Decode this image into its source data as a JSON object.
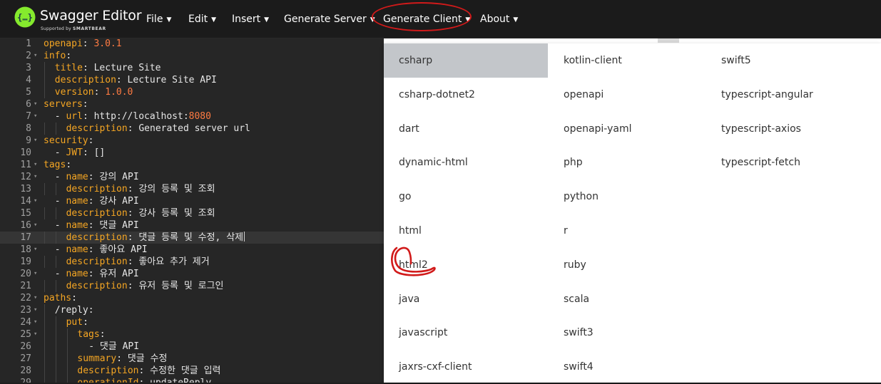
{
  "app": {
    "title": "Swagger Editor",
    "supported_by": "Supported by",
    "supported_by_brand": "SMARTBEAR",
    "brand_color": "#85ea2d"
  },
  "menu": [
    {
      "label": "File"
    },
    {
      "label": "Edit"
    },
    {
      "label": "Insert"
    },
    {
      "label": "Generate Server"
    },
    {
      "label": "Generate Client"
    },
    {
      "label": "About"
    }
  ],
  "annotation_color": "#d11a1a",
  "editor": {
    "active_line": 17,
    "lines": [
      {
        "num": "1",
        "indent": 0,
        "key": "openapi",
        "value": "3.0.1",
        "value_type": "number"
      },
      {
        "num": "2",
        "indent": 0,
        "key": "info",
        "value": "",
        "value_type": "str",
        "fold": true
      },
      {
        "num": "3",
        "indent": 1,
        "key": "title",
        "value": "Lecture Site",
        "value_type": "str"
      },
      {
        "num": "4",
        "indent": 1,
        "key": "description",
        "value": "Lecture Site API",
        "value_type": "str"
      },
      {
        "num": "5",
        "indent": 1,
        "key": "version",
        "value": "1.0.0",
        "value_type": "number"
      },
      {
        "num": "6",
        "indent": 0,
        "key": "servers",
        "value": "",
        "value_type": "str",
        "fold": true
      },
      {
        "num": "7",
        "indent": 1,
        "dash": true,
        "key": "url",
        "value": "http://localhost:",
        "value_type": "str",
        "value_suffix": "8080",
        "fold": true
      },
      {
        "num": "8",
        "indent": 2,
        "key": "description",
        "value": "Generated server url",
        "value_type": "str"
      },
      {
        "num": "9",
        "indent": 0,
        "key": "security",
        "value": "",
        "value_type": "str",
        "fold": true
      },
      {
        "num": "10",
        "indent": 1,
        "dash": true,
        "key": "JWT",
        "value": "[]",
        "value_type": "str"
      },
      {
        "num": "11",
        "indent": 0,
        "key": "tags",
        "value": "",
        "value_type": "str",
        "fold": true
      },
      {
        "num": "12",
        "indent": 1,
        "dash": true,
        "key": "name",
        "value": "강의 API",
        "value_type": "str",
        "fold": true
      },
      {
        "num": "13",
        "indent": 2,
        "key": "description",
        "value": "강의 등록 및 조회",
        "value_type": "str"
      },
      {
        "num": "14",
        "indent": 1,
        "dash": true,
        "key": "name",
        "value": "강사 API",
        "value_type": "str",
        "fold": true
      },
      {
        "num": "15",
        "indent": 2,
        "key": "description",
        "value": "강사 등록 및 조회",
        "value_type": "str"
      },
      {
        "num": "16",
        "indent": 1,
        "dash": true,
        "key": "name",
        "value": "댓글 API",
        "value_type": "str",
        "fold": true
      },
      {
        "num": "17",
        "indent": 2,
        "key": "description",
        "value": "댓글 등록 및 수정, 삭제",
        "value_type": "str"
      },
      {
        "num": "18",
        "indent": 1,
        "dash": true,
        "key": "name",
        "value": "좋아요 API",
        "value_type": "str",
        "fold": true
      },
      {
        "num": "19",
        "indent": 2,
        "key": "description",
        "value": "좋아요 추가 제거",
        "value_type": "str"
      },
      {
        "num": "20",
        "indent": 1,
        "dash": true,
        "key": "name",
        "value": "유저 API",
        "value_type": "str",
        "fold": true
      },
      {
        "num": "21",
        "indent": 2,
        "key": "description",
        "value": "유저 등록 및 로그인",
        "value_type": "str"
      },
      {
        "num": "22",
        "indent": 0,
        "key": "paths",
        "value": "",
        "value_type": "str",
        "fold": true
      },
      {
        "num": "23",
        "indent": 1,
        "key": "/reply",
        "value": "",
        "value_type": "str",
        "key_plain": true,
        "fold": true
      },
      {
        "num": "24",
        "indent": 2,
        "key": "put",
        "value": "",
        "value_type": "str",
        "fold": true
      },
      {
        "num": "25",
        "indent": 3,
        "key": "tags",
        "value": "",
        "value_type": "str",
        "fold": true
      },
      {
        "num": "26",
        "indent": 4,
        "dash": true,
        "key": "",
        "value": "댓글 API",
        "value_type": "str"
      },
      {
        "num": "27",
        "indent": 3,
        "key": "summary",
        "value": "댓글 수정",
        "value_type": "str"
      },
      {
        "num": "28",
        "indent": 3,
        "key": "description",
        "value": "수정한 댓글 입력",
        "value_type": "str"
      },
      {
        "num": "29",
        "indent": 3,
        "key": "operationId",
        "value": "updateReply",
        "value_type": "str"
      }
    ]
  },
  "generate_client_dropdown": {
    "selected": "csharp",
    "columns": [
      [
        "csharp",
        "csharp-dotnet2",
        "dart",
        "dynamic-html",
        "go",
        "html",
        "html2",
        "java",
        "javascript",
        "jaxrs-cxf-client"
      ],
      [
        "kotlin-client",
        "openapi",
        "openapi-yaml",
        "php",
        "python",
        "r",
        "ruby",
        "scala",
        "swift3",
        "swift4"
      ],
      [
        "swift5",
        "typescript-angular",
        "typescript-axios",
        "typescript-fetch"
      ]
    ],
    "circled_item": "html2"
  }
}
